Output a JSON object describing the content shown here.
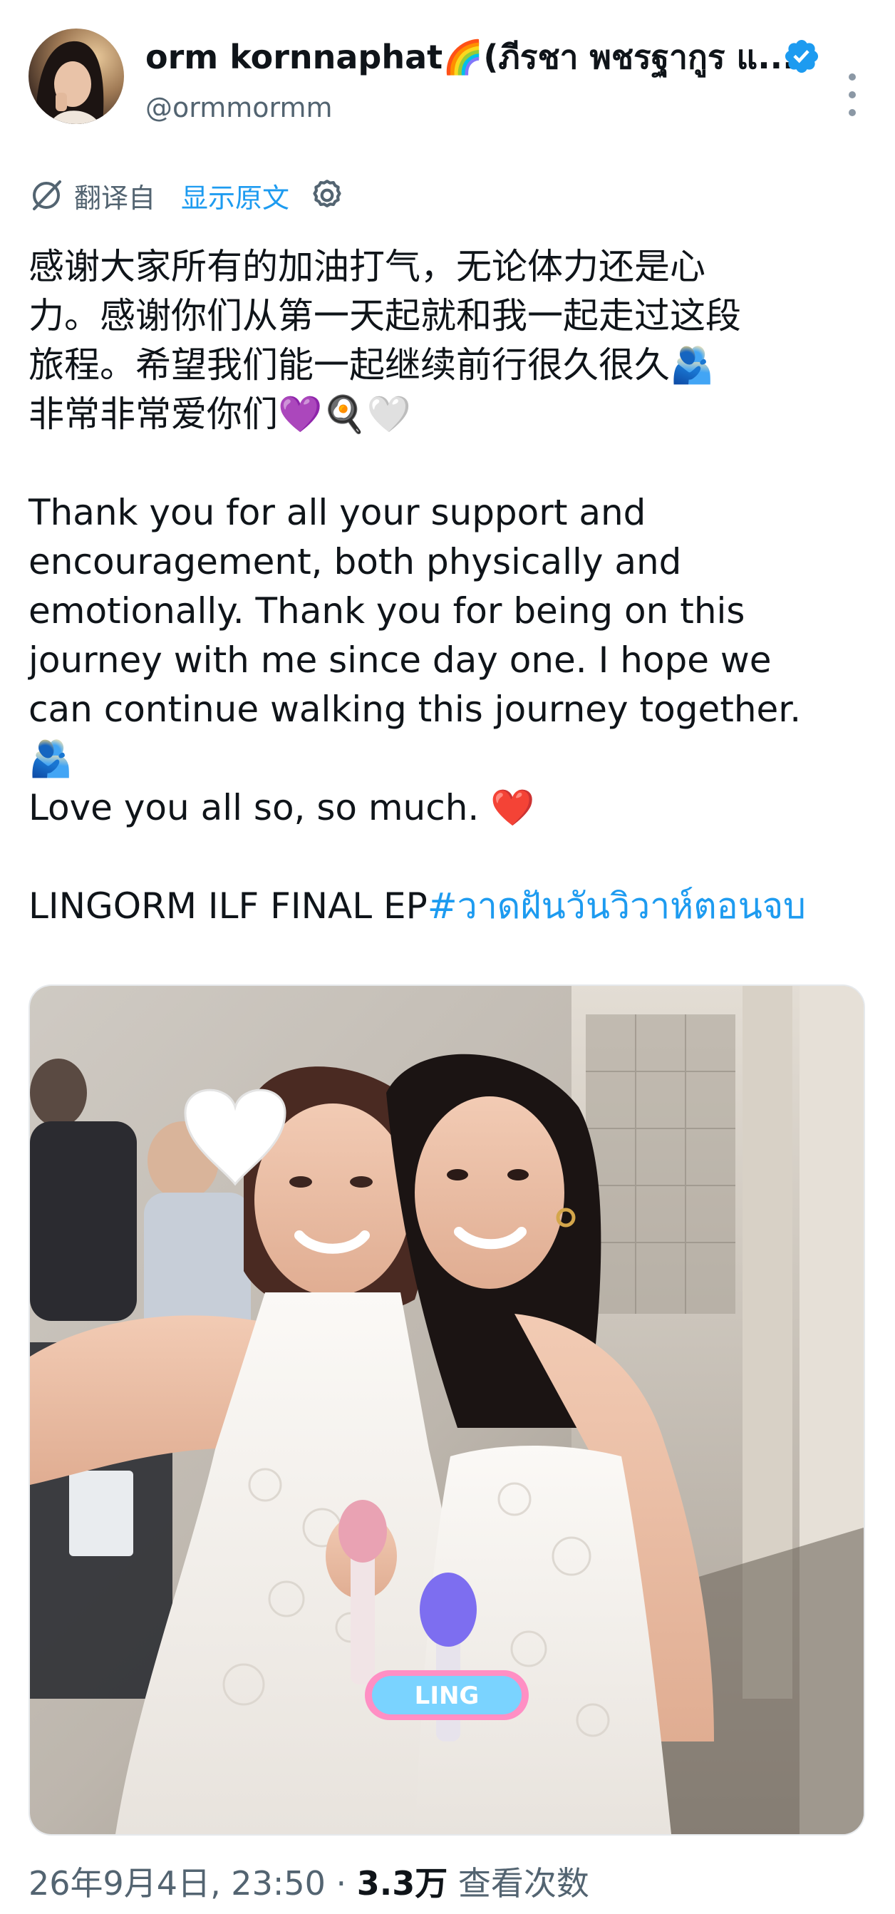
{
  "author": {
    "display_name": "orm kornnaphat🌈(ภีรชา พชรฐากูร แ...",
    "handle": "@ormmormm",
    "verified_color": "#1d9bf0"
  },
  "translation": {
    "translated_from": "翻译自",
    "show_original": "显示原文"
  },
  "tweet": {
    "zh_lines": [
      "感谢大家所有的加油打气，无论体力还是心",
      "力。感谢你们从第一天起就和我一起走过这段",
      "旅程。希望我们能一起继续前行很久很久🫂",
      "非常非常爱你们💜🍳🤍"
    ],
    "en_lines": [
      "Thank you for all your support and",
      "encouragement, both physically and",
      "emotionally. Thank you for being on this",
      "journey with me since day one. I hope we",
      "can continue walking this journey together.",
      "🫂",
      " Love you all so, so much. ❤️"
    ],
    "final_prefix": "LINGORM ILF FINAL EP",
    "hashtag": "#วาดฝันวันวิวาห์ตอนจบ"
  },
  "photo": {
    "overlay_emoji": "🤍",
    "mic_label": "LING"
  },
  "meta": {
    "datetime": "26年9月4日, 23:50",
    "separator": "·",
    "views_count": "3.3万",
    "views_label": "查看次数"
  },
  "icons": {
    "translate": "translate-icon",
    "settings": "gear-icon",
    "more": "more-vertical-icon",
    "verified": "verified-badge-icon"
  }
}
